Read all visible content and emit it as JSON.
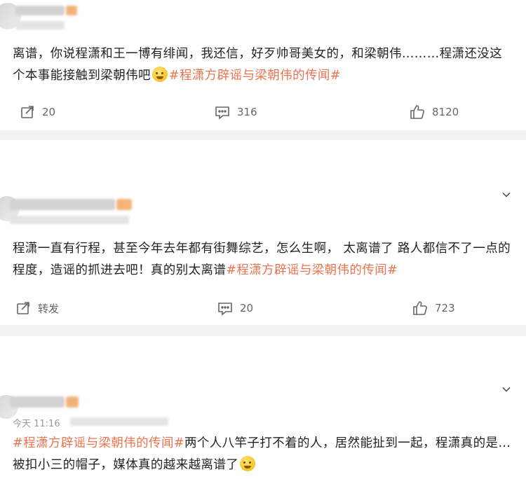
{
  "comments": [
    {
      "text_before_emoji": "离谱，你说程潇和王一博有绯闻，我还信，好歹帅哥美女的，和梁朝伟………程潇还没这个本事能接触到梁朝伟吧",
      "topic": "#程潇方辟谣与梁朝伟的传闻#",
      "repost": "20",
      "comment": "316",
      "like": "8120"
    },
    {
      "text": "程潇一直有行程，甚至今年去年都有街舞综艺，怎么生啊， 太离谱了 路人都信不了一点的程度，造谣的抓进去吧！真的别太离谱",
      "topic": "#程潇方辟谣与梁朝伟的传闻#",
      "repost": "转发",
      "comment": "20",
      "like": "723"
    },
    {
      "time": "今天 11:16",
      "topic": "#程潇方辟谣与梁朝伟的传闻#",
      "text": "两个人八竿子打不着的人，居然能扯到一起，程潇真的是…被扣小三的帽子，媒体真的越来越离谱了"
    }
  ],
  "icons": [
    "repost-icon",
    "comment-icon",
    "like-icon",
    "chevron-down-icon"
  ],
  "colors": {
    "topic": "#eb7350",
    "text": "#222222",
    "meta": "#666666",
    "background": "#f2f2f2"
  }
}
